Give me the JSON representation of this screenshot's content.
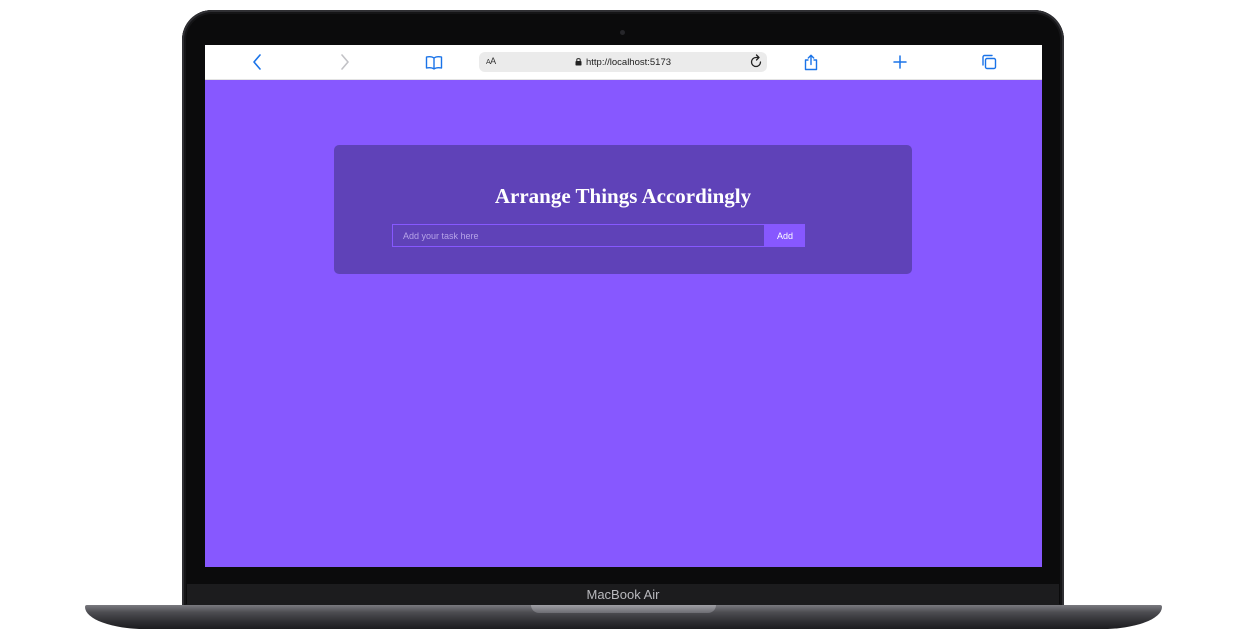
{
  "browser": {
    "url": "http://localhost:5173",
    "reader_label_small": "A",
    "reader_label_large": "A"
  },
  "app": {
    "title": "Arrange Things Accordingly",
    "task_input": {
      "placeholder": "Add your task here",
      "value": ""
    },
    "add_button_label": "Add"
  },
  "device": {
    "brand_label": "MacBook Air"
  },
  "colors": {
    "page_background": "#8758ff",
    "card_background": "#5f42b8",
    "accent": "#8758ff",
    "toolbar_icon_blue": "#1a73e8"
  },
  "icons": {
    "back": "chevron-left-icon",
    "forward": "chevron-right-icon",
    "bookmarks": "book-icon",
    "lock": "lock-icon",
    "reload": "reload-icon",
    "share": "share-icon",
    "new_tab": "plus-icon",
    "tabs": "tabs-icon"
  }
}
